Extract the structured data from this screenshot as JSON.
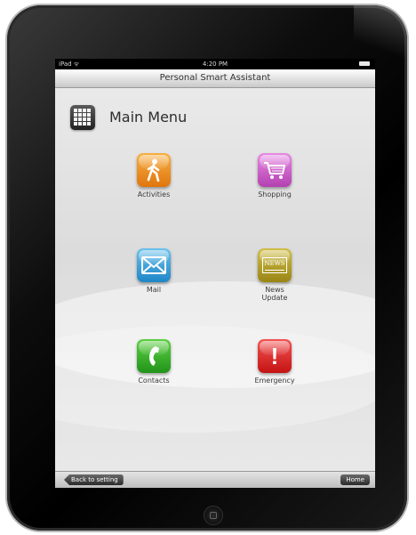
{
  "status_bar": {
    "carrier": "iPad ᯤ",
    "time": "4:20 PM"
  },
  "app": {
    "title": "Personal Smart Assistant"
  },
  "header": {
    "title": "Main Menu",
    "icon": "grid-icon"
  },
  "menu": {
    "activities": {
      "label": "Activities",
      "icon": "walking-person-icon",
      "color": "#f39a28"
    },
    "shopping": {
      "label": "Shopping",
      "icon": "shopping-cart-icon",
      "color": "#d468d0"
    },
    "mail": {
      "label": "Mail",
      "icon": "envelope-icon",
      "color": "#3aa4de"
    },
    "news": {
      "label": "News\nUpdate",
      "icon": "newspaper-icon",
      "color": "#b9a52e",
      "icon_text": "NEWS"
    },
    "contacts": {
      "label": "Contacts",
      "icon": "phone-icon",
      "color": "#36b22c"
    },
    "emergency": {
      "label": "Emergency",
      "icon": "exclamation-icon",
      "color": "#e22a2a",
      "icon_text": "!"
    }
  },
  "bottom_bar": {
    "back_label": "Back to setting",
    "home_label": "Home"
  }
}
